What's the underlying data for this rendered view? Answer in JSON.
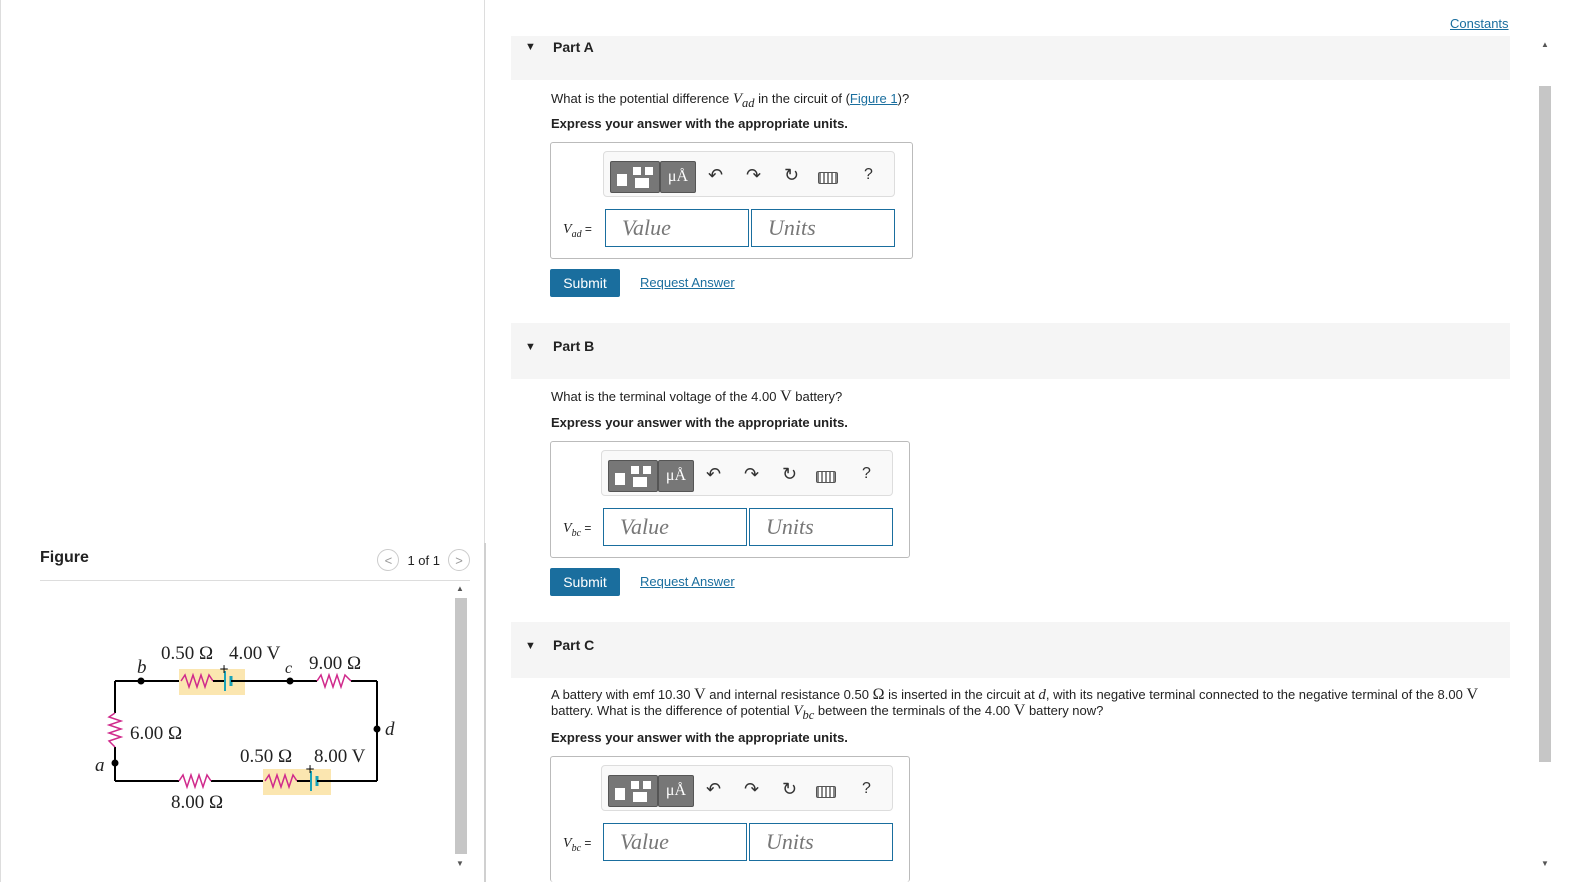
{
  "figure": {
    "title": "Figure",
    "pager": "1 of 1",
    "prev_icon": "chevron-left-icon",
    "next_icon": "chevron-right-icon",
    "circuit": {
      "labels": {
        "b": "b",
        "c": "c",
        "d": "d",
        "a": "a",
        "r_top_left": "0.50 Ω",
        "emf_top": "4.00 V",
        "r_top_right": "9.00 Ω",
        "r_left": "6.00 Ω",
        "r_bot_internal": "0.50 Ω",
        "emf_bot": "8.00 V",
        "r_bot_left": "8.00 Ω",
        "plus_top": "+",
        "plus_bot": "+"
      }
    }
  },
  "constants_link": "Constants",
  "parts": [
    {
      "label": "Part A",
      "question_pre": "What is the potential difference ",
      "question_var": "V",
      "question_sub": "ad",
      "question_mid": " in the circuit of (",
      "question_link": "Figure 1",
      "question_post": ")?",
      "express": "Express your answer with the appropriate units.",
      "var_main": "V",
      "var_sub": "ad",
      "var_eq": " =",
      "value_placeholder": "Value",
      "units_placeholder": "Units",
      "submit": "Submit",
      "request": "Request Answer"
    },
    {
      "label": "Part B",
      "question_pre": "What is the terminal voltage of the 4.00 ",
      "question_unit": "V",
      "question_post": " battery?",
      "express": "Express your answer with the appropriate units.",
      "var_main": "V",
      "var_sub": "bc",
      "var_eq": " =",
      "value_placeholder": "Value",
      "units_placeholder": "Units",
      "submit": "Submit",
      "request": "Request Answer"
    },
    {
      "label": "Part C",
      "question_1": "A battery with emf 10.30 ",
      "question_unit1": "V",
      "question_2": " and internal resistance 0.50 ",
      "question_unit2": "Ω",
      "question_3": " is inserted in the circuit at ",
      "question_var_d": "d",
      "question_4": ", with its negative terminal connected to the negative terminal of the 8.00 ",
      "question_unit3": "V",
      "question_5": " battery. What is the difference of potential ",
      "question_var": "V",
      "question_sub": "bc",
      "question_6": " between the terminals of the 4.00 ",
      "question_unit4": "V",
      "question_7": " battery now?",
      "express": "Express your answer with the appropriate units.",
      "var_main": "V",
      "var_sub": "bc",
      "var_eq": " =",
      "value_placeholder": "Value",
      "units_placeholder": "Units"
    }
  ],
  "toolbar": {
    "units_btn": "μÅ",
    "undo_icon": "undo-icon",
    "redo_icon": "redo-icon",
    "reset_icon": "reset-icon",
    "keyboard_icon": "keyboard-icon",
    "help": "?"
  }
}
